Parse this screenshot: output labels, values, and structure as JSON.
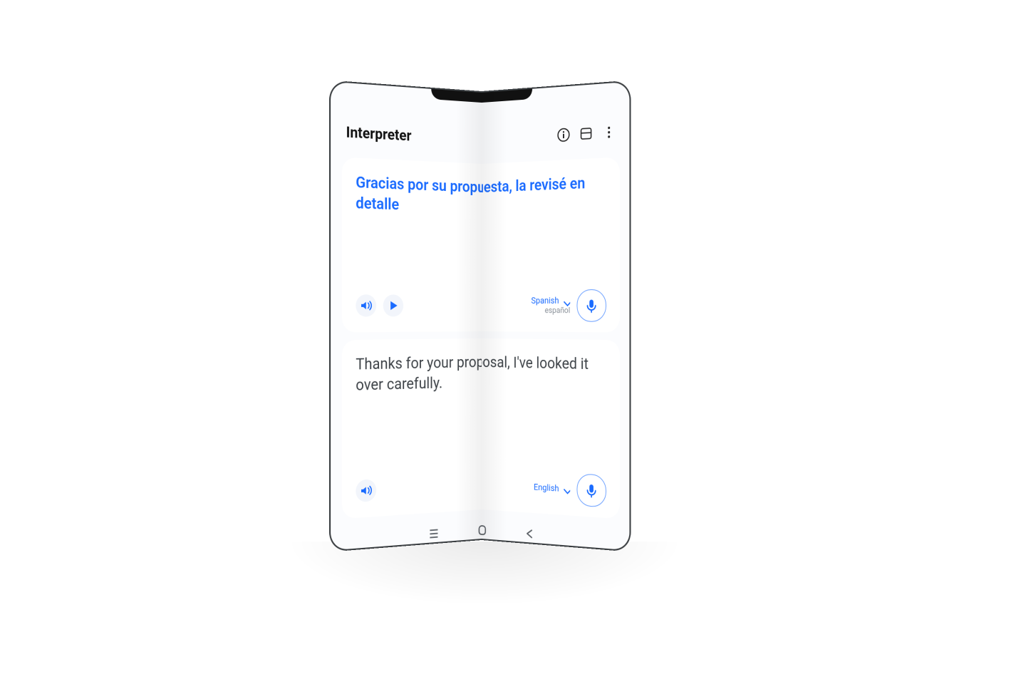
{
  "header": {
    "title": "Interpreter",
    "icons": {
      "info": "info-icon",
      "window": "window-icon",
      "more": "more-icon"
    }
  },
  "source": {
    "text": "Gracias por su propuesta, la revisé en detalle",
    "lang_primary": "Spanish",
    "lang_secondary": "español"
  },
  "target": {
    "text": "Thanks for your proposal, I've looked it over carefully.",
    "lang_primary": "English"
  },
  "colors": {
    "accent": "#1a6bff"
  }
}
